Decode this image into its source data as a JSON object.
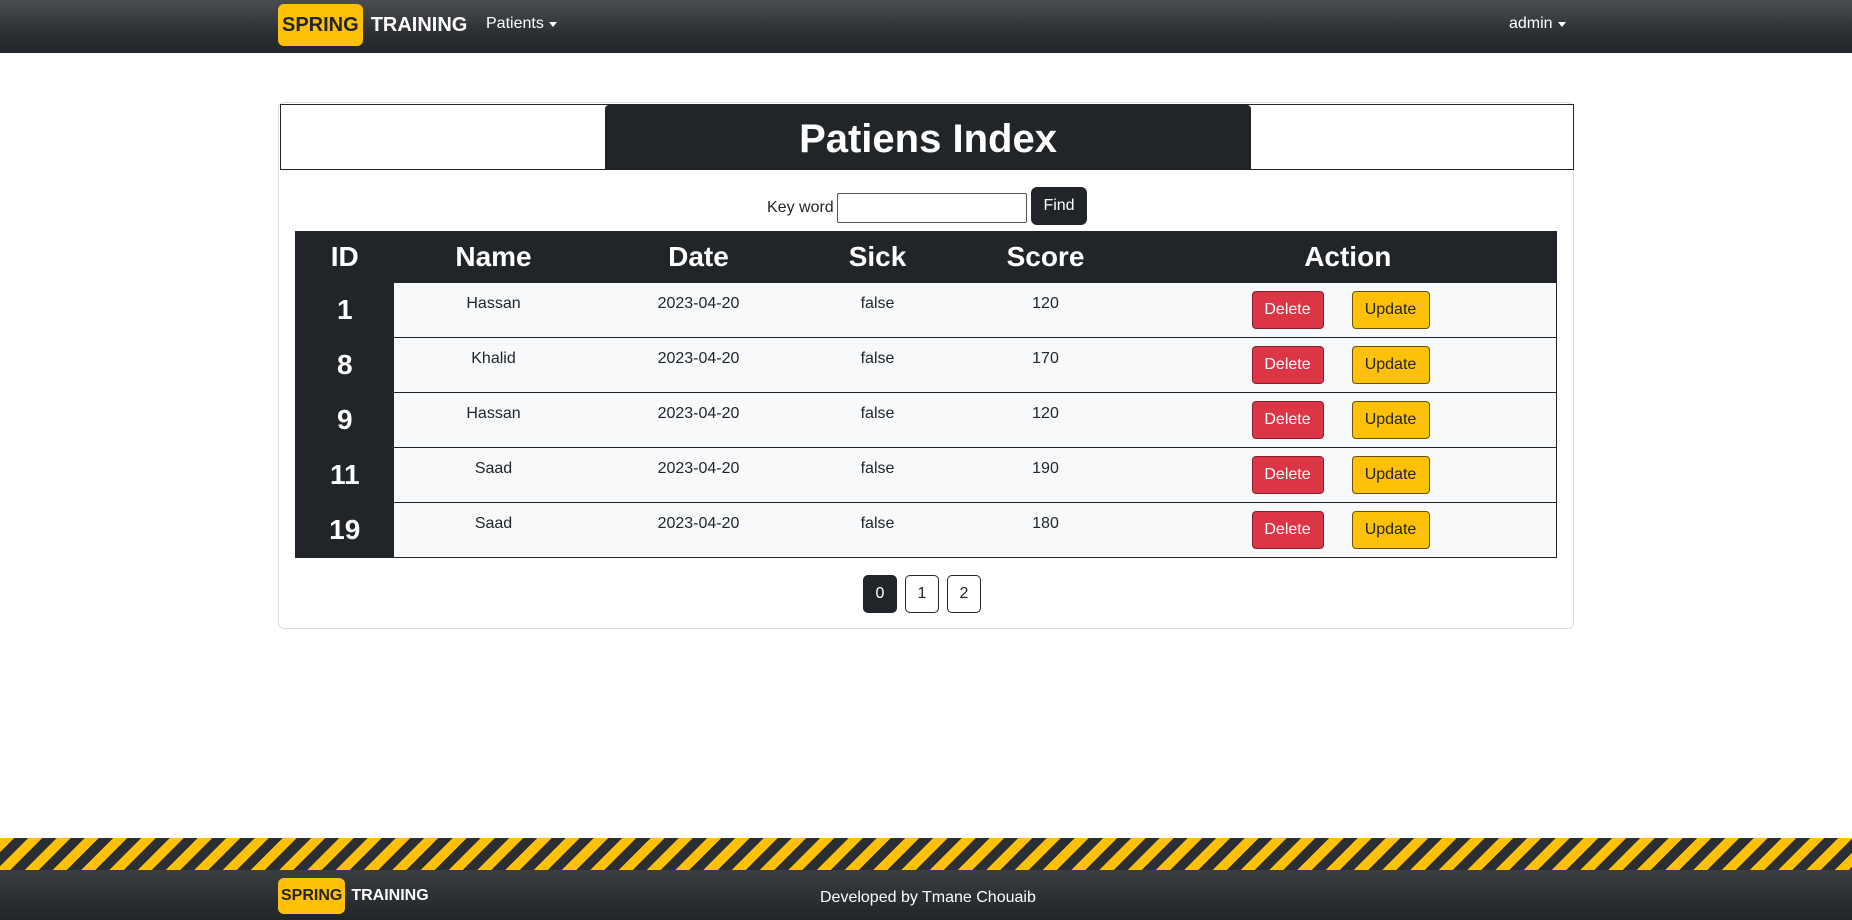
{
  "navbar": {
    "brand_spring": "SPRING",
    "brand_training": "TRAINING",
    "patients_menu": "Patients",
    "user_menu": "admin"
  },
  "card": {
    "title": "Patiens Index",
    "search": {
      "label": "Key word",
      "value": "",
      "button": "Find"
    },
    "table": {
      "headers": [
        "ID",
        "Name",
        "Date",
        "Sick",
        "Score",
        "Action"
      ],
      "rows": [
        {
          "id": "1",
          "name": "Hassan",
          "date": "2023-04-20",
          "sick": "false",
          "score": "120"
        },
        {
          "id": "8",
          "name": "Khalid",
          "date": "2023-04-20",
          "sick": "false",
          "score": "170"
        },
        {
          "id": "9",
          "name": "Hassan",
          "date": "2023-04-20",
          "sick": "false",
          "score": "120"
        },
        {
          "id": "11",
          "name": "Saad",
          "date": "2023-04-20",
          "sick": "false",
          "score": "190"
        },
        {
          "id": "19",
          "name": "Saad",
          "date": "2023-04-20",
          "sick": "false",
          "score": "180"
        }
      ],
      "delete_label": "Delete",
      "update_label": "Update"
    },
    "pagination": [
      "0",
      "1",
      "2"
    ],
    "active_page": "0"
  },
  "footer": {
    "brand_spring": "SPRING",
    "brand_training": "TRAINING",
    "credit": "Developed by Tmane Chouaib"
  },
  "colors": {
    "dark": "#212529",
    "accent_yellow": "#ffc107",
    "danger_red": "#dc3545",
    "row_bg": "#f8f9fa"
  }
}
